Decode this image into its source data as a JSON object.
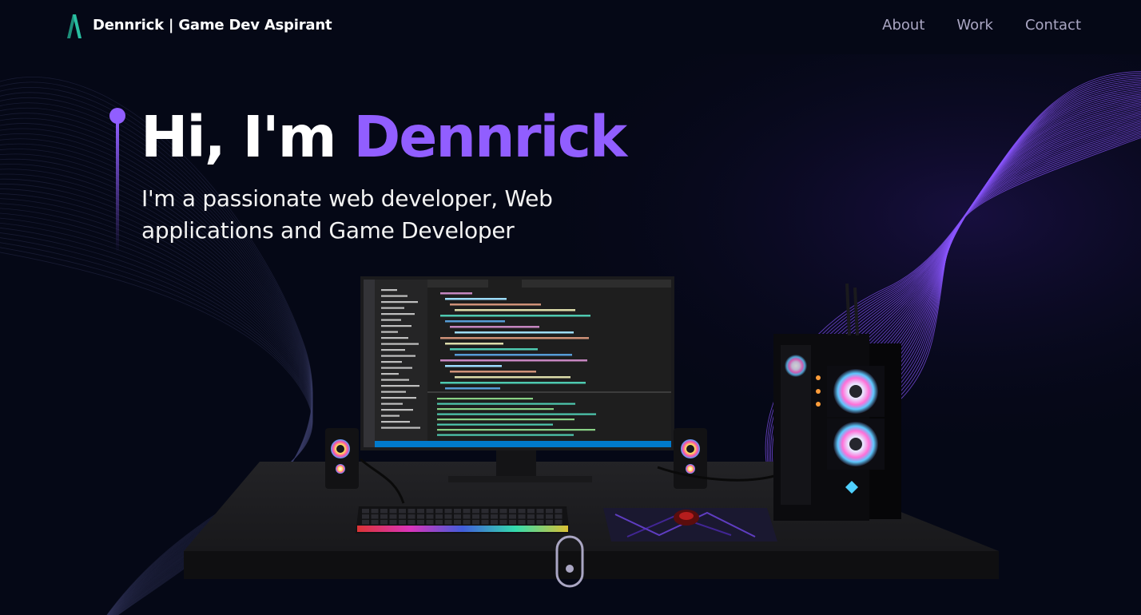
{
  "nav": {
    "brand_name": "Dennrick",
    "brand_tagline": "| Game Dev Aspirant",
    "links": [
      {
        "label": "About"
      },
      {
        "label": "Work"
      },
      {
        "label": "Contact"
      }
    ]
  },
  "hero": {
    "greeting": "Hi, I'm ",
    "name": "Dennrick",
    "subtitle": "I'm a passionate web developer, Web applications and Game Developer"
  },
  "colors": {
    "background": "#050816",
    "accent": "#915eff",
    "nav_text": "#aaa6c3",
    "text": "#ffffff"
  },
  "icons": {
    "logo": "logo-icon",
    "scroll": "scroll-indicator-icon"
  }
}
